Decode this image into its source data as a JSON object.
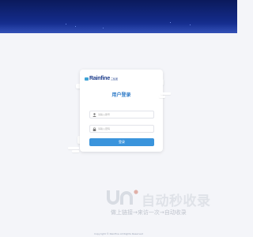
{
  "login": {
    "logo_text": "Rainfine",
    "logo_sub": "三集团",
    "title": "用户登录",
    "username_placeholder": "请输入账号",
    "password_placeholder": "请输入密码",
    "submit_label": "登录"
  },
  "watermark": {
    "brand": "自动秒收录",
    "slogan": "做上链接→来访一次→自动收录"
  },
  "footer": {
    "text": "Copyright © Rainfine All Rights Reserved"
  },
  "colors": {
    "banner": "#132a86",
    "accent": "#3a94dc",
    "title": "#2a78c6",
    "background": "#f4f5f9"
  }
}
